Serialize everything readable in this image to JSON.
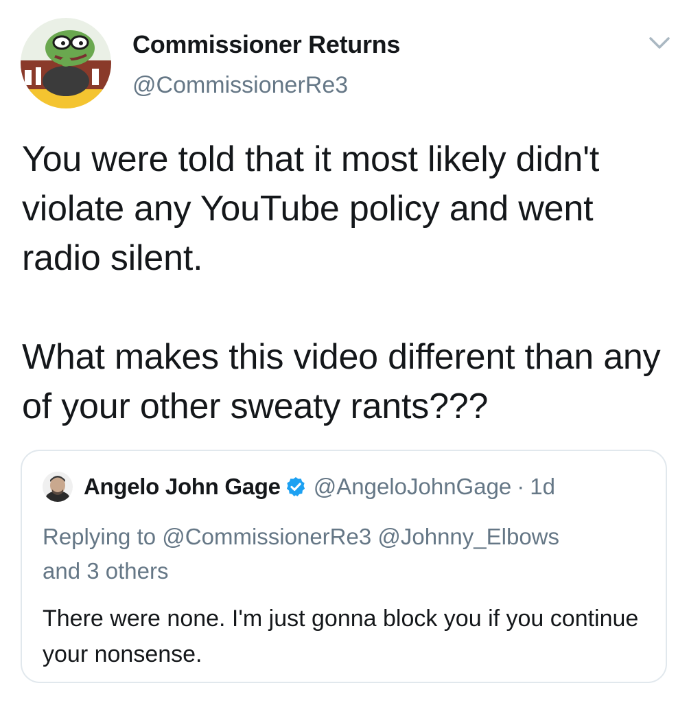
{
  "author": {
    "display_name": "Commissioner Returns",
    "handle": "@CommissionerRe3",
    "avatar_icon": "frog-cartoon-avatar"
  },
  "menu": {
    "icon": "chevron-down-icon"
  },
  "tweet": {
    "text": "You were told that it most likely didn't violate any YouTube policy and went radio silent.\n\nWhat makes this video different than any of your other sweaty rants???"
  },
  "quoted_tweet": {
    "author_name": "Angelo John Gage",
    "verified_icon": "verified-badge-icon",
    "handle": "@AngeloJohnGage",
    "separator": "·",
    "time": "1d",
    "replying_prefix": "Replying to",
    "replying_to": "@CommissionerRe3 @Johnny_Elbows",
    "replying_suffix": "and 3 others",
    "text": "There were none. I'm just gonna block you if you continue your nonsense."
  },
  "colors": {
    "primary_text": "#14171a",
    "secondary_text": "#657786",
    "border": "#e1e8ed",
    "verified_blue": "#1da1f2"
  }
}
